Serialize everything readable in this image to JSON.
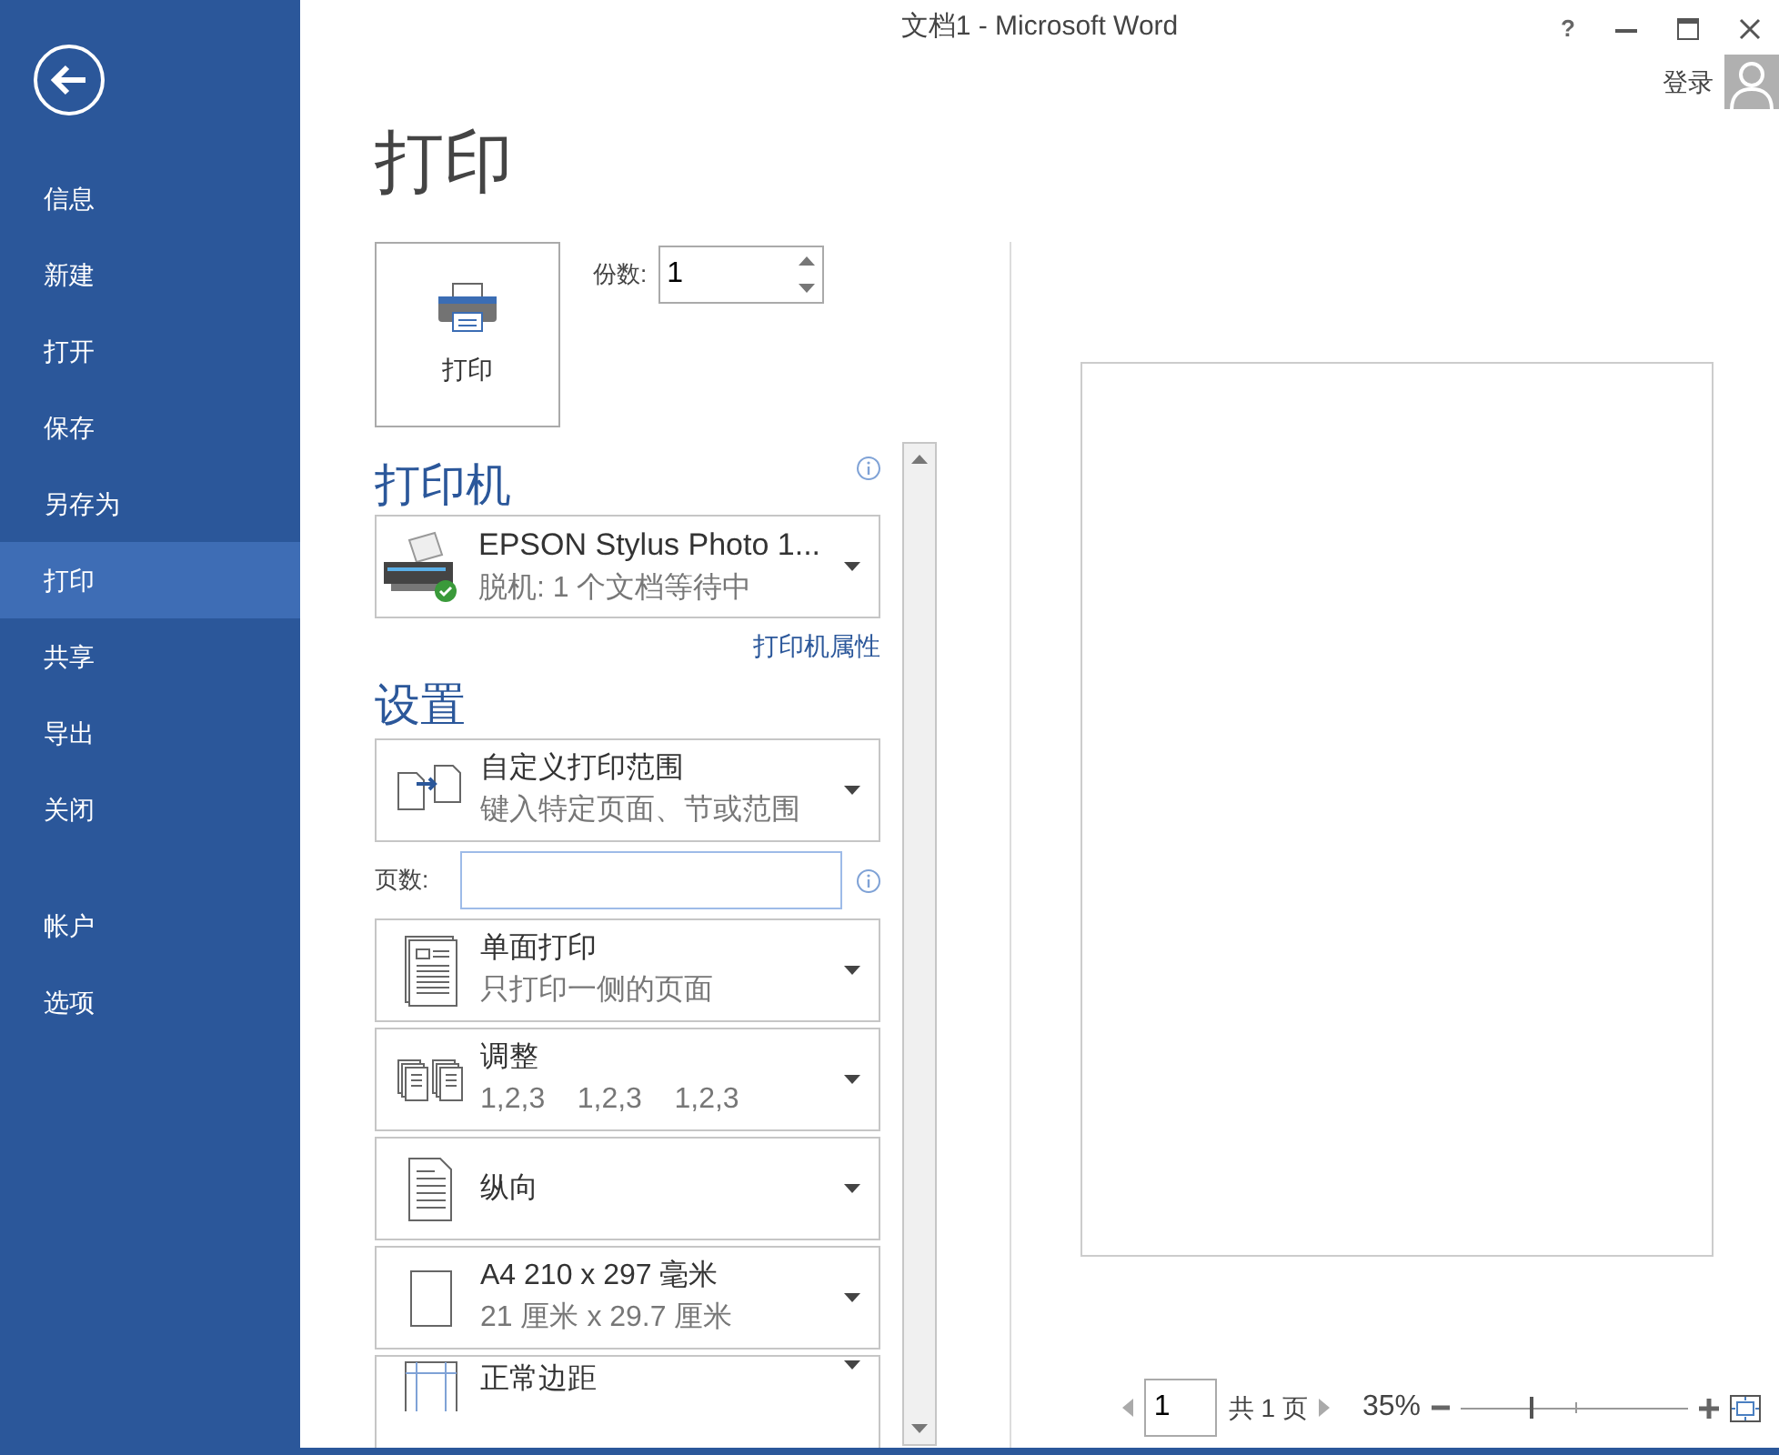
{
  "window": {
    "title": "文档1 - Microsoft Word",
    "controls": [
      "?"
    ]
  },
  "account": {
    "label": "登录"
  },
  "sidebar": {
    "groups": [
      {
        "items": [
          {
            "label": "信息",
            "selected": false
          },
          {
            "label": "新建",
            "selected": false
          },
          {
            "label": "打开",
            "selected": false
          },
          {
            "label": "保存",
            "selected": false
          },
          {
            "label": "另存为",
            "selected": false
          },
          {
            "label": "打印",
            "selected": true
          },
          {
            "label": "共享",
            "selected": false
          },
          {
            "label": "导出",
            "selected": false
          },
          {
            "label": "关闭",
            "selected": false
          }
        ]
      },
      {
        "items": [
          {
            "label": "帐户",
            "selected": false
          },
          {
            "label": "选项",
            "selected": false
          }
        ]
      }
    ]
  },
  "page_title": "打印",
  "print_button": {
    "label": "打印"
  },
  "copies": {
    "label": "份数:",
    "value": "1"
  },
  "printer": {
    "heading": "打印机",
    "name": "EPSON Stylus Photo 1...",
    "status": "脱机: 1 个文档等待中",
    "properties_link": "打印机属性"
  },
  "settings": {
    "heading": "设置",
    "options": [
      {
        "kind": "range",
        "title": "自定义打印范围",
        "subtitle": "键入特定页面、节或范围"
      },
      {
        "kind": "pages_field",
        "label": "页数:"
      },
      {
        "kind": "sides",
        "title": "单面打印",
        "subtitle": "只打印一侧的页面"
      },
      {
        "kind": "collate",
        "title": "调整",
        "subtitle": "1,2,3    1,2,3    1,2,3"
      },
      {
        "kind": "orientation",
        "title": "纵向"
      },
      {
        "kind": "paper",
        "title": "A4 210 x 297 毫米",
        "subtitle": "21 厘米 x 29.7 厘米"
      },
      {
        "kind": "margins",
        "title": "正常边距"
      }
    ]
  },
  "preview": {
    "page_input": "1",
    "page_total": "共 1 页",
    "zoom": "35%",
    "zoom_slider": {
      "level": 0.3
    }
  }
}
